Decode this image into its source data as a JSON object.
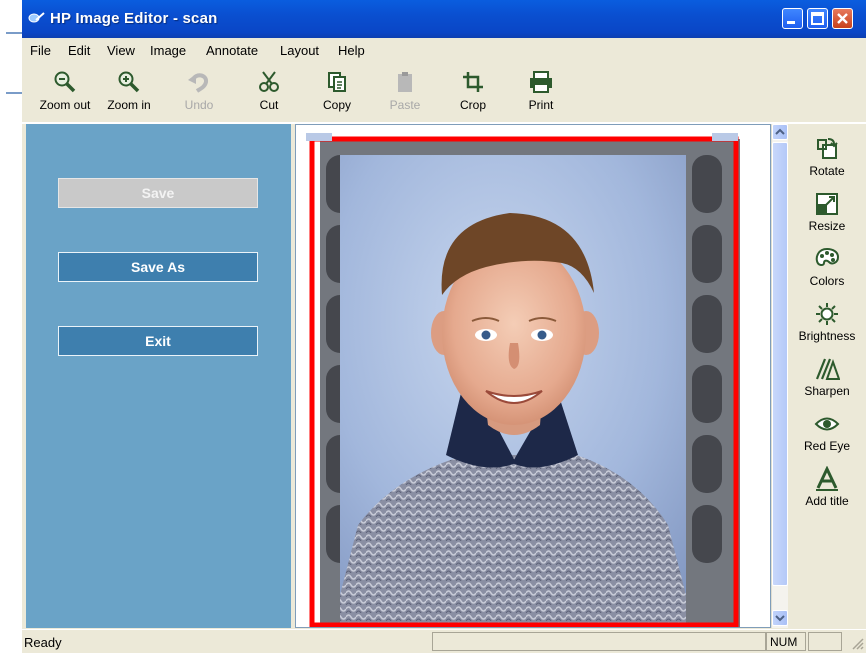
{
  "window": {
    "title": "HP Image Editor - scan"
  },
  "menu": [
    "File",
    "Edit",
    "View",
    "Image",
    "Annotate",
    "Layout",
    "Help"
  ],
  "toolbar": [
    {
      "label": "Zoom out",
      "icon": "zoom-out-icon",
      "enabled": true
    },
    {
      "label": "Zoom in",
      "icon": "zoom-in-icon",
      "enabled": true
    },
    {
      "label": "Undo",
      "icon": "undo-icon",
      "enabled": false
    },
    {
      "label": "Cut",
      "icon": "cut-icon",
      "enabled": true
    },
    {
      "label": "Copy",
      "icon": "copy-icon",
      "enabled": true
    },
    {
      "label": "Paste",
      "icon": "paste-icon",
      "enabled": false
    },
    {
      "label": "Crop",
      "icon": "crop-icon",
      "enabled": true
    },
    {
      "label": "Print",
      "icon": "print-icon",
      "enabled": true
    }
  ],
  "left_panel": {
    "save_label": "Save",
    "save_as_label": "Save As",
    "exit_label": "Exit"
  },
  "right_tools": [
    {
      "label": "Rotate",
      "icon": "rotate-icon"
    },
    {
      "label": "Resize",
      "icon": "resize-icon"
    },
    {
      "label": "Colors",
      "icon": "colors-palette-icon"
    },
    {
      "label": "Brightness",
      "icon": "brightness-sun-icon"
    },
    {
      "label": "Sharpen",
      "icon": "sharpen-icon"
    },
    {
      "label": "Red Eye",
      "icon": "red-eye-icon"
    },
    {
      "label": "Add title",
      "icon": "add-title-icon"
    }
  ],
  "status": {
    "text": "Ready",
    "num_indicator": "NUM"
  },
  "colors": {
    "titlebar": "#0a4fd0",
    "left_panel": "#6aa3c7",
    "panel_button": "#3e7fae",
    "selection_border": "#ff0000",
    "photo_background": "#a9bedf"
  }
}
